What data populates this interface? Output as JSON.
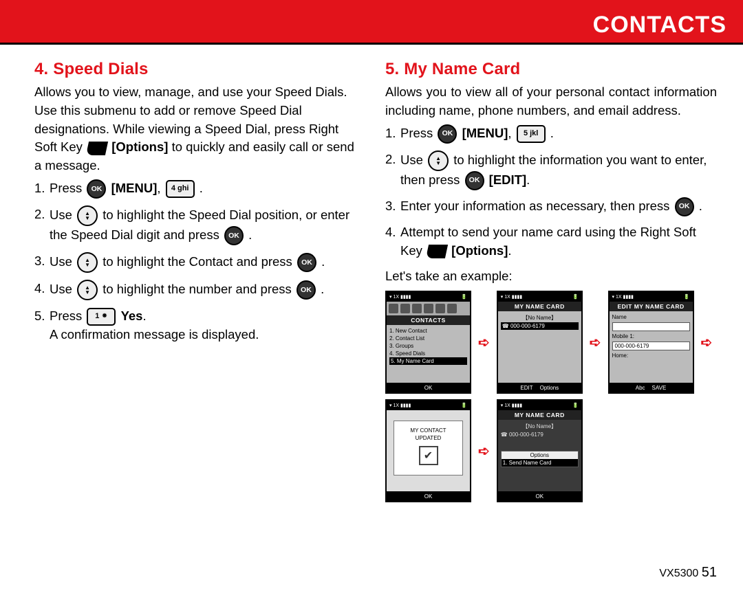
{
  "header": {
    "title": "CONTACTS"
  },
  "left": {
    "heading": "4. Speed Dials",
    "intro_a": "Allows you to view, manage, and use your Speed Dials. Use this submenu to add or remove Speed Dial designations. While viewing a Speed Dial, press Right Soft Key ",
    "options_label": "[Options]",
    "intro_b": " to quickly and easily call or send a message.",
    "s1_a": "Press ",
    "menu_label": "[MENU]",
    "s1_b": ", ",
    "key4": "4 ghi",
    "s1_c": " .",
    "s2_a": "Use ",
    "s2_b": " to highlight the Speed Dial position, or enter the Speed Dial digit and press ",
    "s2_c": " .",
    "s3_a": "Use ",
    "s3_b": " to highlight the Contact and press ",
    "s3_c": " .",
    "s4_a": "Use ",
    "s4_b": " to highlight the number and press ",
    "s4_c": " .",
    "s5_a": "Press ",
    "key1": "1 ⁕",
    "yes_label": "Yes",
    "s5_b": ".",
    "s5_confirm": "A confirmation message is displayed."
  },
  "right": {
    "heading": "5. My Name Card",
    "intro": "Allows you to view all of your personal contact information including name, phone numbers, and email address.",
    "s1_a": "Press ",
    "menu_label": "[MENU]",
    "s1_b": ", ",
    "key5": "5 jkl",
    "s1_c": " .",
    "s2_a": "Use ",
    "s2_b": " to highlight the information you want to enter, then press ",
    "edit_label": "[EDIT]",
    "s2_c": ".",
    "s3": "Enter your information as necessary, then press ",
    "s3_b": " .",
    "s4_a": "Attempt to send your name card using the Right Soft Key ",
    "options_label": "[Options]",
    "s4_b": ".",
    "example": "Let's take an example:"
  },
  "screens": {
    "s1": {
      "status": "▾ 1X ▮▮▮▮",
      "title": "CONTACTS",
      "rows": [
        "1.  New Contact",
        "2.  Contact List",
        "3.  Groups",
        "4.  Speed Dials",
        "5.  My Name Card"
      ],
      "bot": "OK"
    },
    "s2": {
      "status": "▾ 1X ▮▮▮▮",
      "title": "MY NAME CARD",
      "rows": [
        "【No Name】",
        "☎ 000-000-6179"
      ],
      "bot_l": "EDIT",
      "bot_r": "Options"
    },
    "s3": {
      "status": "▾ 1X ▮▮▮▮",
      "title": "EDIT MY NAME CARD",
      "name_lbl": "Name",
      "mobile_lbl": "Mobile 1:",
      "mobile_val": "000-000-6179",
      "home_lbl": "Home:",
      "bot_l": "Abc",
      "bot_r": "SAVE"
    },
    "s4": {
      "status": "▾ 1X ▮▮▮▮",
      "msg1": "MY CONTACT",
      "msg2": "UPDATED",
      "bot": "OK"
    },
    "s5": {
      "status": "▾ 1X ▮▮▮▮",
      "title": "MY NAME CARD",
      "rows": [
        "【No Name】",
        "☎ 000-000-6179"
      ],
      "opt_title": "Options",
      "opt1": "1. Send Name Card",
      "bot": "OK"
    }
  },
  "footer": {
    "model": "VX5300",
    "page": "51"
  }
}
